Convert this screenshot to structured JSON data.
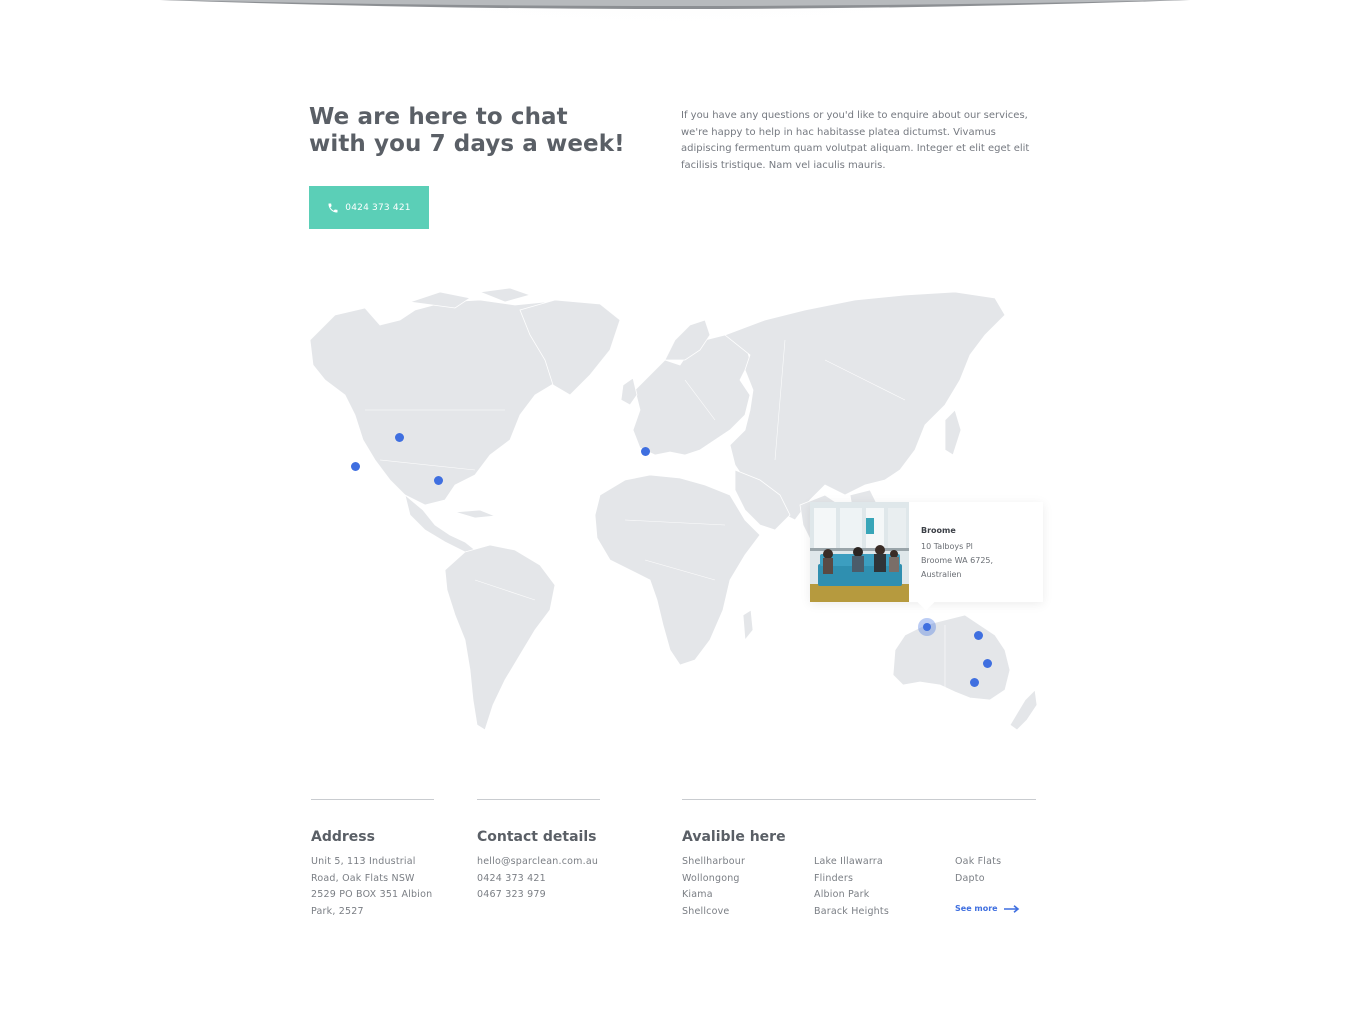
{
  "intro": {
    "title_line1": "We are here to chat",
    "title_line2": "with you 7 days a week!",
    "text": "If you have any questions or you'd like to enquire about our services, we're happy to help in hac habitasse platea dictumst. Vivamus adipiscing fermentum quam volutpat aliquam. Integer et elit eget elit facilisis tristique. Nam vel iaculis mauris.",
    "phone_label": "0424 373 421",
    "button_color": "#5bcfb7"
  },
  "map": {
    "popup": {
      "city": "Broome",
      "address_line1": "10 Talboys Pl",
      "address_line2": "Broome WA 6725,",
      "address_line3": "Australien"
    },
    "pin_color": "#3f6fe0"
  },
  "footer": {
    "address": {
      "title": "Address",
      "lines": [
        "Unit 5, 113 Industrial",
        "Road, Oak Flats NSW",
        "2529 PO BOX 351 Albion",
        "Park, 2527"
      ]
    },
    "contact": {
      "title": "Contact details",
      "email": "hello@sparclean.com.au",
      "phone1": "0424 373 421",
      "phone2": "0467 323 979"
    },
    "available": {
      "title": "Avalible here",
      "col1": [
        "Shellharbour",
        "Wollongong",
        "Kiama",
        "Shellcove"
      ],
      "col2": [
        "Lake Illawarra",
        "Flinders",
        "Albion Park",
        "Barack Heights"
      ],
      "col3": [
        "Oak Flats",
        "Dapto"
      ],
      "see_more": "See more"
    }
  }
}
